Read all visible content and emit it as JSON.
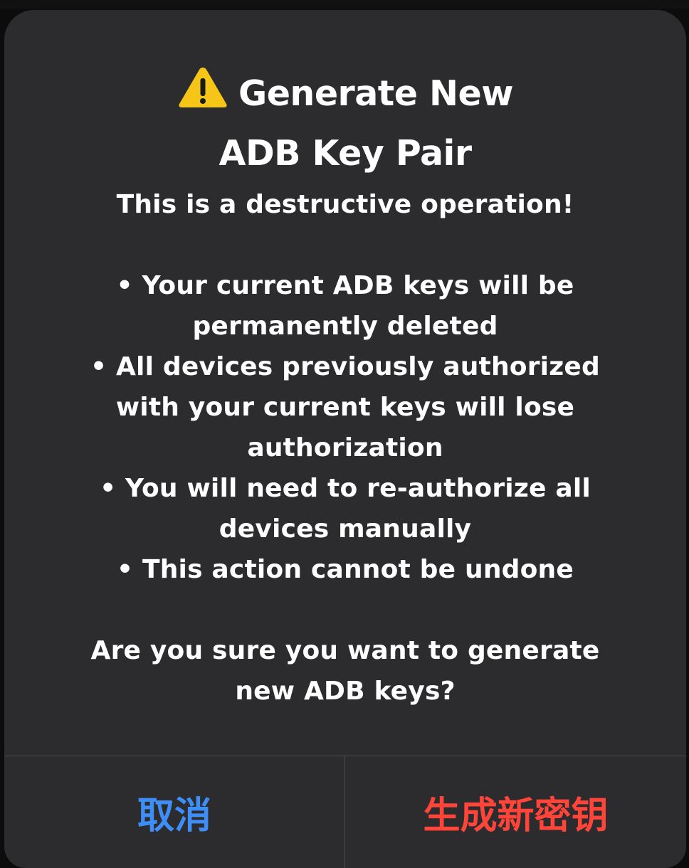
{
  "dialog": {
    "title_line1": "Generate New",
    "title_line2": "ADB Key Pair",
    "message_lines": [
      "This is a destructive operation!",
      "",
      "• Your current ADB keys will be",
      "permanently deleted",
      "• All devices previously authorized",
      "with your current keys will lose",
      "authorization",
      "• You will need to re-authorize all",
      "devices manually",
      "• This action cannot be undone",
      "",
      "Are you sure you want to generate",
      "new ADB keys?"
    ],
    "icon": "warning-icon",
    "cancel_label": "取消",
    "confirm_label": "生成新密钥",
    "colors": {
      "background": "#2c2c2e",
      "cancel": "#3d8ef7",
      "destructive": "#ff453a",
      "warning_icon": "#f5c518"
    }
  }
}
